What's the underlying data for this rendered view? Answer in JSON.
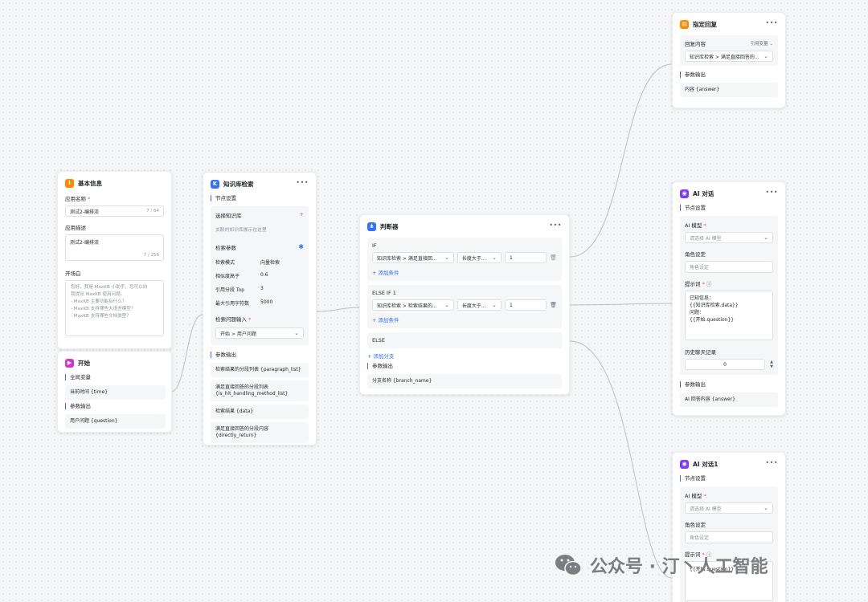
{
  "colors": {
    "accent": "#3370ff",
    "basic_info_icon": "#ff8800",
    "start_icon": "#d136d1",
    "search_icon": "#3370ff",
    "condition_icon": "#3370ff",
    "reply_icon": "#ff8800",
    "ai_icon": "#7f3bf5",
    "wire": "#b9bec6"
  },
  "more_glyph": "•••",
  "basic": {
    "title": "基本信息",
    "app_name_label": "应用名称",
    "app_name_value": "测试2-编排流",
    "app_name_counter": "7 / 64",
    "desc_label": "应用描述",
    "desc_value": "测试2-编排流",
    "desc_counter": "7 / 256",
    "opening_label": "开场白",
    "opening_lines": [
      "您好，我是 MaxKB 小助手，您可以向",
      "我提出 MaxKB 使用问题。",
      "- MaxKB 主要功能有什么？",
      "- MaxKB 支持哪些大语言模型？",
      "- MaxKB 支持哪些文档类型？"
    ]
  },
  "start": {
    "title": "开始",
    "global_vars_label": "全局变量",
    "global_var": "当前时间 {time}",
    "params_label": "参数输出",
    "param": "用户问题 {question}"
  },
  "search": {
    "title": "知识库检索",
    "settings_label": "节点设置",
    "kb_label": "选择知识库",
    "kb_add": "+",
    "kb_hint": "关联的知识库展示在这里",
    "params_label": "检索参数",
    "params": [
      {
        "k": "检索模式",
        "v": "向量检索"
      },
      {
        "k": "相似度高于",
        "v": "0.6"
      },
      {
        "k": "引用分段 Top",
        "v": "3"
      },
      {
        "k": "最大引用字符数",
        "v": "5000"
      }
    ],
    "question_label": "检索问题输入",
    "question_value": "开始 > 用户问题",
    "output_label": "参数输出",
    "outputs": [
      "检索结果的分段列表 {paragraph_list}",
      "满足直接回答的分段列表 {is_hit_handling_method_list}",
      "检索结果 {data}",
      "满足直接回答的分段内容 {directly_return}"
    ]
  },
  "condition": {
    "title": "判断器",
    "if_label": "IF",
    "if_field": "知识库检索 > 满足直接回...",
    "if_op": "长度大于...",
    "if_value": "1",
    "add_cond_1": "+ 添加条件",
    "elseif_label": "ELSE IF 1",
    "elseif_field": "知识库检索 > 检索结果的...",
    "elseif_op": "长度大于...",
    "elseif_value": "1",
    "add_cond_2": "+ 添加条件",
    "else_label": "ELSE",
    "add_branch": "+ 添加分支",
    "output_label": "参数输出",
    "output": "分支名称 {branch_name}"
  },
  "reply": {
    "title": "指定回复",
    "content_label": "回复内容",
    "mode": "引用变量",
    "content_value": "知识库检索 > 满足直接回答的...",
    "output_label": "参数输出",
    "output": "内容 {answer}"
  },
  "ai1": {
    "title": "AI 对话",
    "settings_label": "节点设置",
    "model_label": "AI 模型",
    "model_placeholder": "请选择 AI 模型",
    "role_label": "角色设定",
    "role_placeholder": "角色设定",
    "prompt_label": "提示词",
    "prompt_lines": [
      "已知信息：",
      "{{知识库检索.data}}",
      "问题：",
      "{{开始.question}}"
    ],
    "history_label": "历史聊天记录",
    "history_value": "0",
    "output_label": "参数输出",
    "output": "AI 回答内容 {answer}"
  },
  "ai2": {
    "title": "AI 对话1",
    "settings_label": "节点设置",
    "model_label": "AI 模型",
    "model_placeholder": "请选择 AI 模型",
    "role_label": "角色设定",
    "role_placeholder": "角色设定",
    "prompt_label": "提示词",
    "prompt_text": "{{开始.question}}"
  },
  "watermark": {
    "text": "公众号 · 汀丶人工智能"
  }
}
